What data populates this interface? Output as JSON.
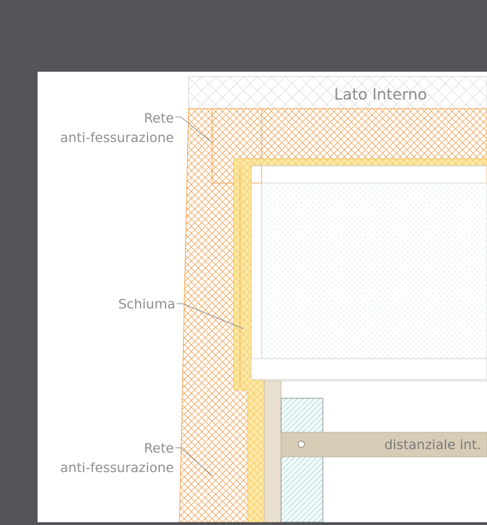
{
  "diagram": {
    "interior_side_label": "Lato Interno",
    "labels": [
      {
        "id": "rete_top_1",
        "text": "Rete"
      },
      {
        "id": "rete_top_2",
        "text": "anti-fessurazione"
      },
      {
        "id": "schiuma",
        "text": "Schiuma"
      },
      {
        "id": "rete_bottom_1",
        "text": "Rete"
      },
      {
        "id": "rete_bottom_2",
        "text": "anti-fessurazione"
      }
    ],
    "spacer_label": "distanziale int."
  },
  "colors": {
    "background": "#555459",
    "paper": "#ffffff",
    "orange_hatch": "#f0a150",
    "foam_fill": "#fde9a6",
    "foam_line": "#f5c35a",
    "beige": "#d8ccb6",
    "cyan_hatch": "#9ed4d8",
    "leader": "#8e8e8e"
  }
}
